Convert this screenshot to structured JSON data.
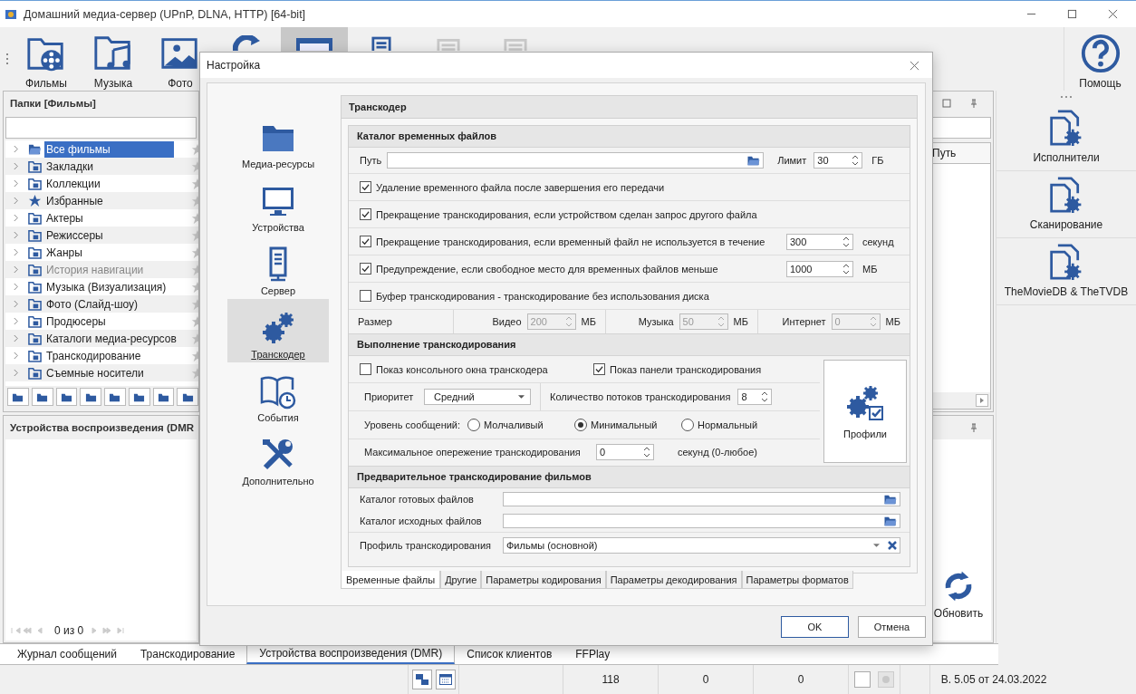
{
  "window": {
    "title": "Домашний медиа-сервер (UPnP, DLNA, HTTP) [64-bit]"
  },
  "toolbar": [
    {
      "label": "Фильмы",
      "kind": "film",
      "selected": false,
      "disabled": false
    },
    {
      "label": "Музыка",
      "kind": "music",
      "selected": false,
      "disabled": false
    },
    {
      "label": "Фото",
      "kind": "photo",
      "selected": false,
      "disabled": false
    },
    {
      "kind": "refresh",
      "selected": false,
      "disabled": false
    },
    {
      "kind": "screen",
      "selected": true,
      "disabled": false
    },
    {
      "kind": "server",
      "selected": false,
      "disabled": false
    },
    {
      "kind": "device",
      "selected": false,
      "disabled": true
    },
    {
      "kind": "device",
      "selected": false,
      "disabled": true
    }
  ],
  "help_button": {
    "label": "Помощь"
  },
  "folders_panel": {
    "title": "Папки [Фильмы]",
    "items": [
      {
        "label": "Все фильмы",
        "kind": "open",
        "selected": true,
        "disabled": false
      },
      {
        "label": "Закладки",
        "kind": "folder",
        "selected": false,
        "disabled": false
      },
      {
        "label": "Коллекции",
        "kind": "folder",
        "selected": false,
        "disabled": false
      },
      {
        "label": "Избранные",
        "kind": "star",
        "selected": false,
        "disabled": false
      },
      {
        "label": "Актеры",
        "kind": "folder",
        "selected": false,
        "disabled": false
      },
      {
        "label": "Режиссеры",
        "kind": "folder",
        "selected": false,
        "disabled": false
      },
      {
        "label": "Жанры",
        "kind": "folder",
        "selected": false,
        "disabled": false
      },
      {
        "label": "История навигации",
        "kind": "folder",
        "selected": false,
        "disabled": true
      },
      {
        "label": "Музыка (Визуализация)",
        "kind": "folder",
        "selected": false,
        "disabled": false
      },
      {
        "label": "Фото (Слайд-шоу)",
        "kind": "folder",
        "selected": false,
        "disabled": false
      },
      {
        "label": "Продюсеры",
        "kind": "folder",
        "selected": false,
        "disabled": false
      },
      {
        "label": "Каталоги медиа-ресурсов",
        "kind": "folder",
        "selected": false,
        "disabled": false
      },
      {
        "label": "Транскодирование",
        "kind": "folder",
        "selected": false,
        "disabled": false
      },
      {
        "label": "Съемные носители",
        "kind": "folder",
        "selected": false,
        "disabled": false
      }
    ]
  },
  "devices_panel": {
    "title": "Устройства воспроизведения (DMR",
    "pager": "0 из 0"
  },
  "files_panel": {
    "column": "Путь"
  },
  "refresh_button": {
    "label": "Обновить"
  },
  "side_actions": [
    {
      "label": "Исполнители"
    },
    {
      "label": "Сканирование"
    },
    {
      "label": "TheMovieDB & TheTVDB"
    }
  ],
  "bottom_tabs": [
    {
      "label": "Журнал сообщений",
      "selected": false
    },
    {
      "label": "Транскодирование",
      "selected": false
    },
    {
      "label": "Устройства воспроизведения (DMR)",
      "selected": true
    },
    {
      "label": "Список клиентов",
      "selected": false
    },
    {
      "label": "FFPlay",
      "selected": false
    }
  ],
  "status_bar": {
    "cells": [
      "118",
      "0",
      "0"
    ],
    "version": "В. 5.05 от 24.03.2022"
  },
  "dialog": {
    "title": "Настройка",
    "nav": [
      {
        "label": "Медиа-ресурсы",
        "kind": "folder",
        "selected": false
      },
      {
        "label": "Устройства",
        "kind": "monitor",
        "selected": false
      },
      {
        "label": "Сервер",
        "kind": "server",
        "selected": false
      },
      {
        "label": "Транскодер",
        "kind": "gears",
        "selected": true
      },
      {
        "label": "События",
        "kind": "book",
        "selected": false
      },
      {
        "label": "Дополнительно",
        "kind": "tools",
        "selected": false
      }
    ],
    "section_title": "Транскодер",
    "temp_group": {
      "title": "Каталог временных файлов",
      "path_label": "Путь",
      "limit_label": "Лимит",
      "limit": "30",
      "limit_unit": "ГБ",
      "options": [
        {
          "label": "Удаление временного файла после завершения его передачи",
          "checked": true
        },
        {
          "label": "Прекращение транскодирования, если устройством сделан запрос другого файла",
          "checked": true
        },
        {
          "label": "Прекращение транскодирования, если временный файл не используется в течение",
          "checked": true,
          "value": "300",
          "unit": "секунд"
        },
        {
          "label": "Предупреждение, если свободное место для временных файлов меньше",
          "checked": true,
          "value": "1000",
          "unit": "МБ"
        },
        {
          "label": "Буфер транскодирования - транскодирование без использования диска",
          "checked": false
        }
      ],
      "size_label": "Размер",
      "sizes": [
        {
          "label": "Видео",
          "value": "200",
          "unit": "МБ",
          "disabled": true
        },
        {
          "label": "Музыка",
          "value": "50",
          "unit": "МБ",
          "disabled": true
        },
        {
          "label": "Интернет",
          "value": "0",
          "unit": "МБ",
          "disabled": true
        }
      ]
    },
    "exec_group": {
      "title": "Выполнение транскодирования",
      "checks": [
        {
          "label": "Показ консольного окна транскодера",
          "checked": false
        },
        {
          "label": "Показ панели транскодирования",
          "checked": true
        }
      ],
      "priority_label": "Приоритет",
      "priority": "Средний",
      "threads_label": "Количество потоков транскодирования",
      "threads": "8",
      "level_label": "Уровень сообщений:",
      "levels": [
        {
          "label": "Молчаливый",
          "selected": false
        },
        {
          "label": "Минимальный",
          "selected": true
        },
        {
          "label": "Нормальный",
          "selected": false
        }
      ],
      "lead_label": "Максимальное опережение транскодирования",
      "lead": "0",
      "lead_unit": "секунд (0-любое)",
      "profiles_button": "Профили"
    },
    "pre_group": {
      "title": "Предварительное транскодирование фильмов",
      "fields": [
        {
          "label": "Каталог готовых файлов",
          "kind": "folder"
        },
        {
          "label": "Каталог исходных файлов",
          "kind": "folder"
        },
        {
          "label": "Профиль транскодирования",
          "kind": "profile",
          "value": "Фильмы (основной)"
        }
      ]
    },
    "tabs": [
      {
        "label": "Временные файлы",
        "selected": true
      },
      {
        "label": "Другие",
        "selected": false
      },
      {
        "label": "Параметры кодирования",
        "selected": false
      },
      {
        "label": "Параметры декодирования",
        "selected": false
      },
      {
        "label": "Параметры форматов",
        "selected": false
      }
    ],
    "buttons": [
      {
        "label": "OK",
        "kind": "primary"
      },
      {
        "label": "Отмена",
        "kind": "normal"
      }
    ]
  }
}
